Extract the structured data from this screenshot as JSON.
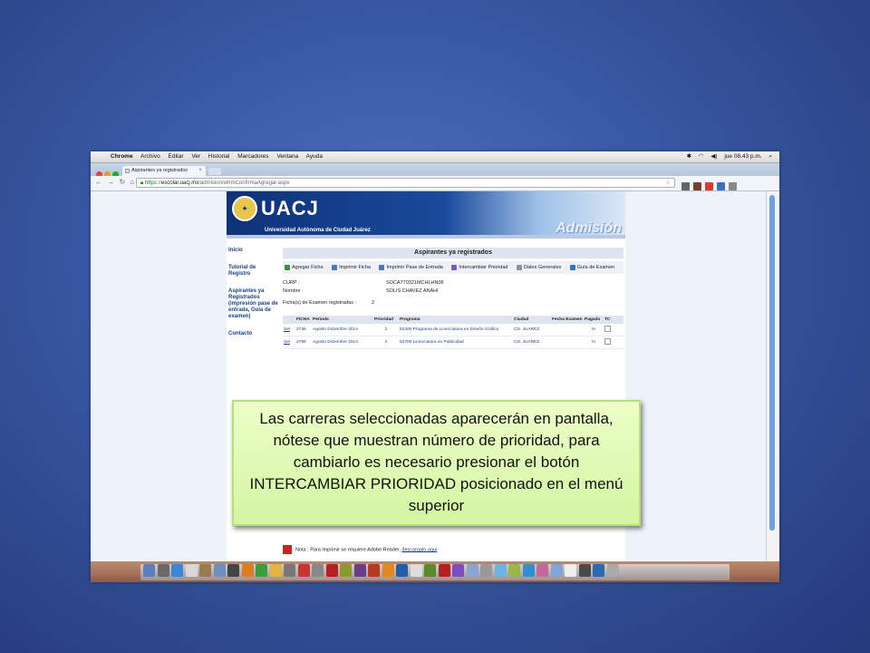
{
  "menubar": {
    "items": [
      "Chrome",
      "Archivo",
      "Editar",
      "Ver",
      "Historial",
      "Marcadores",
      "Ventana",
      "Ayuda"
    ],
    "clock": "jue 08.43 p.m."
  },
  "browser": {
    "tab_title": "Aspirantes ya registrados",
    "url_scheme": "https",
    "url_host": "escolar.uacj.mx",
    "url_path": "/admision/wfrmConfirmaAgregar.aspx"
  },
  "site": {
    "logo_text": "UACJ",
    "university_name": "Universidad Autónoma de Ciudad Juárez",
    "section_banner": "Admisión",
    "nav": [
      "Inicio",
      "Tutorial de Registro",
      "Aspirantes ya Registrados (impresión pase de entrada, Guía de examen)",
      "Contacto"
    ],
    "content_title": "Aspirantes ya registrados",
    "actions": [
      "Agregar Ficha",
      "Imprimir Ficha",
      "Imprimir Pase de Entrada",
      "Intercambiar Prioridad",
      "Datos Generales",
      "Guía de Examen"
    ],
    "curp_label": "CURP :",
    "curp_value": "SOCA770321MCHLHN06",
    "nombre_label": "Nombre :",
    "nombre_value": "SOLIS CHAVEZ ANAHI",
    "fichas_label": "Ficha(s) de Examen registradas :",
    "fichas_count": "2",
    "table": {
      "headers": [
        "",
        "FICHA",
        "Periodo",
        "Prioridad",
        "Programa",
        "Ciudad",
        "Fecha Examen",
        "Pagado",
        "TC"
      ],
      "rows": [
        {
          "sel": "Sel",
          "ficha": "2736",
          "periodo": "Agosto Diciembre 2014",
          "prioridad": "1",
          "programa": "52200 Programa de Licenciatura en Diseño Gráfico",
          "ciudad": "CD. JUAREZ",
          "fecha": "",
          "pagado": "N"
        },
        {
          "sel": "Sel",
          "ficha": "2799",
          "periodo": "Agosto Diciembre 2014",
          "prioridad": "2",
          "programa": "52700 Licenciatura en Publicidad",
          "ciudad": "CD. JUAREZ",
          "fecha": "",
          "pagado": "N"
        }
      ]
    },
    "note_prefix": "Nota : Para imprimir se requiere Adobe Reader,",
    "note_link": "descargalo aqui"
  },
  "callout": {
    "text": "Las carreras seleccionadas aparecerán en pantalla, nótese que muestran número de prioridad, para cambiarlo es necesario presionar el botón INTERCAMBIAR PRIORIDAD posicionado en el menú superior"
  },
  "colors": {
    "slide_bg": "#3a5aa6",
    "callout_bg": "#d4f5a2",
    "banner_blue": "#0e3278",
    "link_blue": "#1b3f86"
  }
}
